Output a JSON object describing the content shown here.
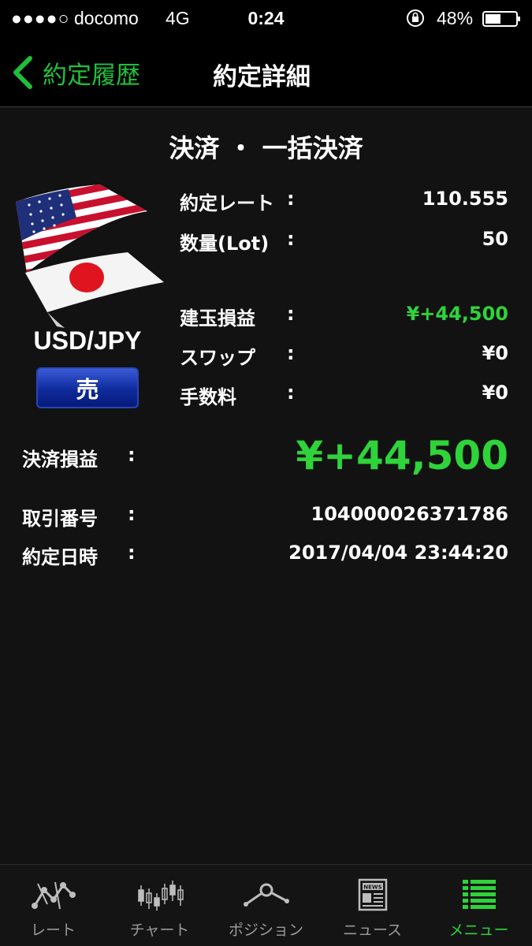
{
  "status_bar": {
    "signal": "●●●●○",
    "carrier": "docomo",
    "network": "4G",
    "time": "0:24",
    "battery_pct": "48%"
  },
  "nav": {
    "back_label": "約定履歴",
    "title": "約定詳細"
  },
  "detail": {
    "section_title": "決済 ・ 一括決済",
    "pair": "USD/JPY",
    "side": "売",
    "colon": ":",
    "rows": [
      {
        "label": "約定レート",
        "value": "110.555"
      },
      {
        "label": "数量(Lot)",
        "value": "50"
      },
      {
        "label": "建玉損益",
        "value": "¥+44,500"
      },
      {
        "label": "スワップ",
        "value": "¥0"
      },
      {
        "label": "手数料",
        "value": "¥0"
      }
    ],
    "settlement_pl_label": "決済損益",
    "settlement_pl_value": "¥+44,500",
    "trade_no_label": "取引番号",
    "trade_no_value": "104000026371786",
    "trade_time_label": "約定日時",
    "trade_time_value": "2017/04/04 23:44:20"
  },
  "colors": {
    "accent_green": "#2fd33a",
    "sell_blue": "#0e2a9c"
  },
  "tabs": [
    {
      "label": "レート",
      "icon": "rate-icon"
    },
    {
      "label": "チャート",
      "icon": "candlestick-icon"
    },
    {
      "label": "ポジション",
      "icon": "position-icon"
    },
    {
      "label": "ニュース",
      "icon": "news-icon"
    },
    {
      "label": "メニュー",
      "icon": "menu-list-icon",
      "active": true
    }
  ]
}
